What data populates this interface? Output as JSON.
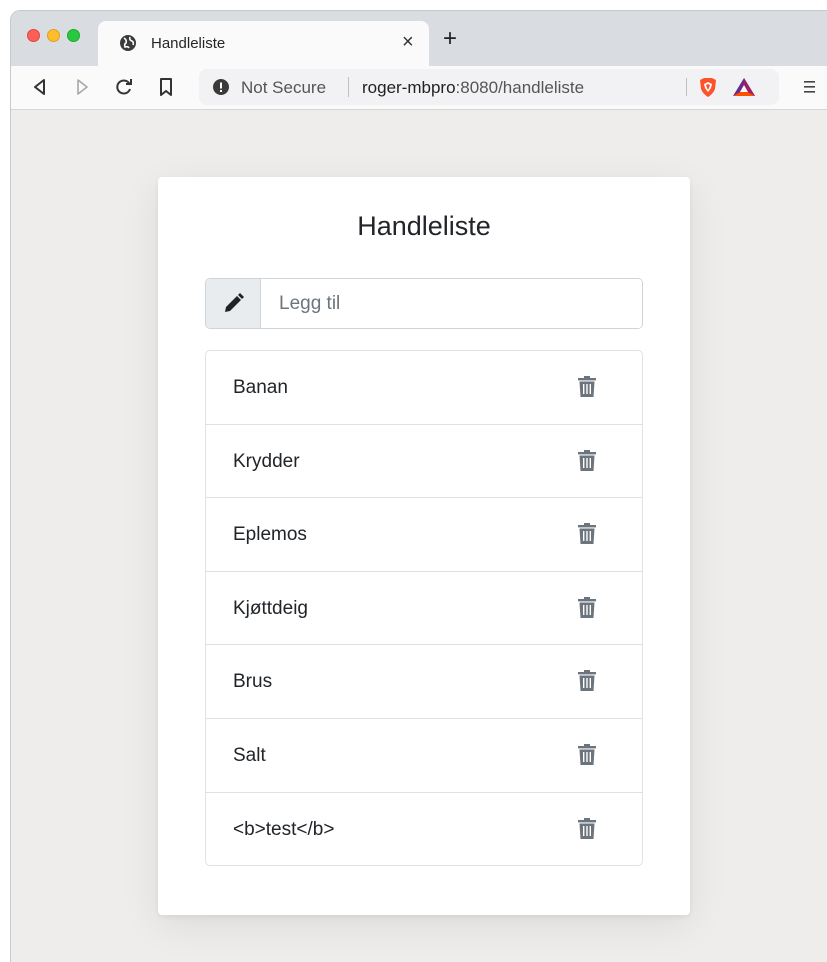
{
  "browser": {
    "tab_title": "Handleliste",
    "tab_close": "×",
    "new_tab": "+",
    "security_label": "Not Secure",
    "url_host": "roger-mbpro",
    "url_rest": ":8080/handleliste"
  },
  "app": {
    "title": "Handleliste",
    "input_placeholder": "Legg til",
    "input_value": "",
    "items": [
      {
        "label": "Banan"
      },
      {
        "label": "Krydder"
      },
      {
        "label": "Eplemos"
      },
      {
        "label": "Kjøttdeig"
      },
      {
        "label": "Brus"
      },
      {
        "label": "Salt"
      },
      {
        "label": "<b>test</b>"
      }
    ]
  },
  "icons": {
    "tab": "globe-icon",
    "input_addon": "pencil-icon",
    "delete": "trash-icon"
  },
  "colors": {
    "page_bg": "#efedeb",
    "titlebar": "#d9dce1",
    "trash": "#6c757d",
    "brave": "#fb542b"
  }
}
